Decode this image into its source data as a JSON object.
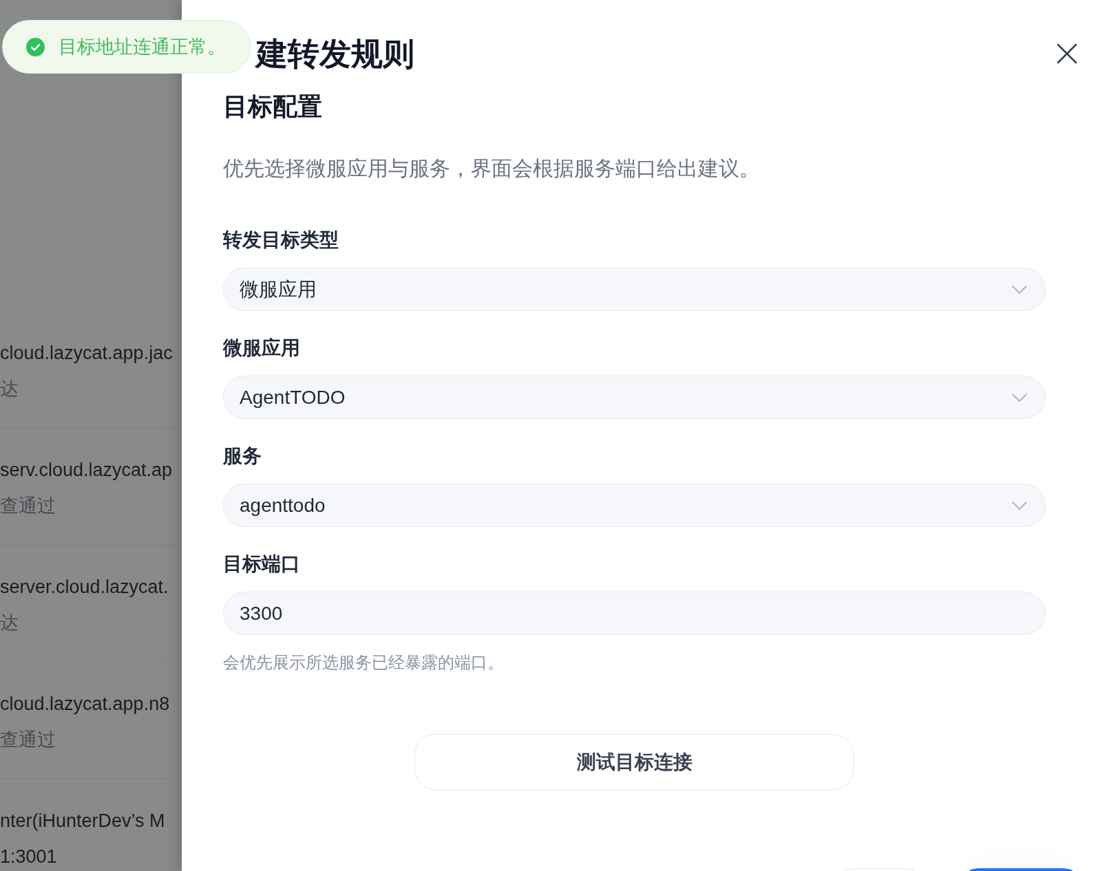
{
  "background_list": [
    {
      "title": "cloud.lazycat.app.jac",
      "subtitle": "达",
      "kind": "status"
    },
    {
      "title": "serv.cloud.lazycat.ap",
      "subtitle": "查通过",
      "kind": "status"
    },
    {
      "title": "server.cloud.lazycat.",
      "subtitle": "达",
      "kind": "status"
    },
    {
      "title": "cloud.lazycat.app.n8",
      "subtitle": "查通过",
      "kind": "status"
    },
    {
      "title": "nter(iHunterDev’s M",
      "subtitle": "1:3001",
      "kind": "address"
    }
  ],
  "toast": {
    "kind": "success",
    "message": "目标地址连通正常。"
  },
  "drawer": {
    "title": "建转发规则",
    "section_title": "目标配置",
    "description": "优先选择微服应用与服务，界面会根据服务端口给出建议。",
    "fields": [
      {
        "label": "转发目标类型",
        "kind": "select",
        "value": "微服应用"
      },
      {
        "label": "微服应用",
        "kind": "select",
        "value": "AgentTODO"
      },
      {
        "label": "服务",
        "kind": "select",
        "value": "agenttodo"
      },
      {
        "label": "目标端口",
        "kind": "input",
        "value": "3300",
        "hint": "会优先展示所选服务已经暴露的端口。"
      }
    ],
    "test_button": "测试目标连接"
  }
}
